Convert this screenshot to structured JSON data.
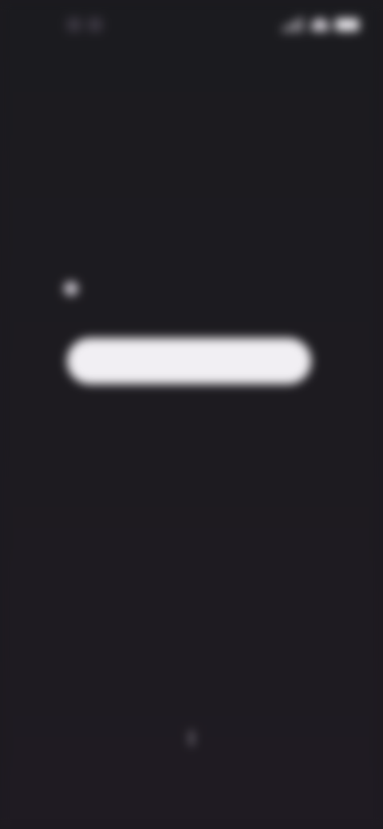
{
  "status_bar": {
    "time": "",
    "icons": [
      "signal-icon",
      "wifi-icon",
      "battery-icon"
    ]
  },
  "main": {
    "notice_text": "",
    "primary_button_label": "",
    "secondary_link_label": ""
  },
  "footer": {
    "left_link_label": "",
    "right_link_label": ""
  },
  "colors": {
    "background": "#1c1a1f",
    "button_background": "#f1eff3",
    "text": "#d8d4dc"
  }
}
